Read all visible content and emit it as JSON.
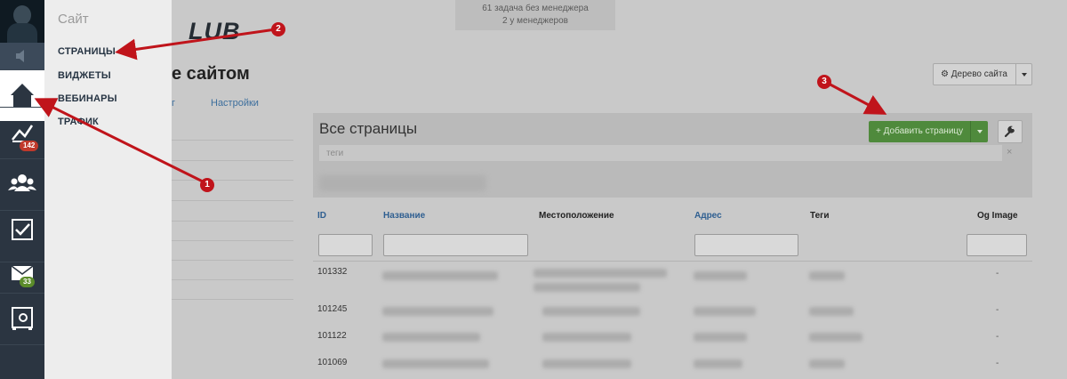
{
  "notification": {
    "line1": "61 задача без менеджера",
    "line2": "2 у менеджеров"
  },
  "logo": {
    "text": "LUB"
  },
  "page": {
    "title": "е сайтом"
  },
  "tabs": [
    {
      "label": "г"
    },
    {
      "label": "Настройки"
    }
  ],
  "site_tree_button": {
    "label": "Дерево сайта",
    "icon": "gear-icon"
  },
  "flyout": {
    "title": "Сайт",
    "items": [
      {
        "label": "СТРАНИЦЫ"
      },
      {
        "label": "ВИДЖЕТЫ"
      },
      {
        "label": "ВЕБИНАРЫ"
      },
      {
        "label": "ТРАФИК"
      }
    ]
  },
  "rail": {
    "badges": {
      "stats": "142",
      "mail": "33"
    },
    "badge_colors": {
      "stats": "#c0392b",
      "mail": "#5b8c2a"
    },
    "icons": [
      "home-icon",
      "chart-icon",
      "users-icon",
      "checkbox-icon",
      "mail-icon",
      "safe-icon"
    ]
  },
  "panel": {
    "title": "Все страницы",
    "add_button": "Добавить страницу",
    "tags_placeholder": "теги",
    "tags_clear": "×"
  },
  "table": {
    "headers": {
      "id": "ID",
      "name": "Название",
      "location": "Местоположение",
      "address": "Адрес",
      "tags": "Теги",
      "og_image": "Og Image"
    },
    "rows": [
      {
        "id": "101332",
        "og_image": "-"
      },
      {
        "id": "101245",
        "og_image": "-"
      },
      {
        "id": "101122",
        "og_image": "-"
      },
      {
        "id": "101069",
        "og_image": "-"
      }
    ]
  },
  "annotations": {
    "markers": [
      "1",
      "2",
      "3"
    ],
    "color": "#c0141b"
  }
}
